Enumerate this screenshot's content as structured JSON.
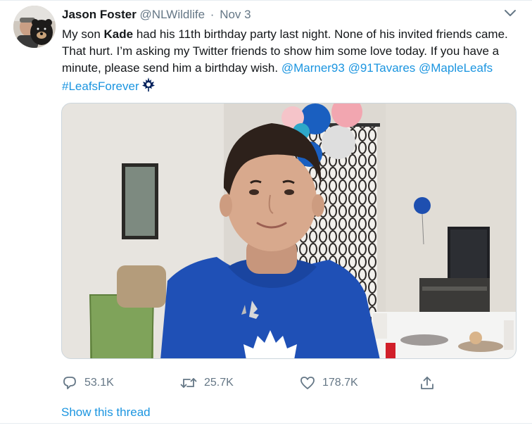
{
  "author": {
    "display_name": "Jason Foster",
    "handle": "@NLWildlife",
    "separator": "·",
    "timestamp": "Nov 3"
  },
  "tweet": {
    "text_1": "My son ",
    "text_bold": "Kade",
    "text_2": " had his 11th birthday party last night. None of his invited friends came. That hurt. I’m asking my Twitter friends to show him some love today. If you have a minute, please send him a birthday wish. ",
    "mention_1": "@Marner93",
    "mention_2": "@91Tavares",
    "mention_3": "@MapleLeafs",
    "hashtag": "#LeafsForever",
    "hashtag_emoji": "maple-leaf-icon"
  },
  "actions": {
    "reply_count": "53.1K",
    "retweet_count": "25.7K",
    "like_count": "178.7K"
  },
  "show_thread_label": "Show this thread",
  "colors": {
    "link": "#1b95e0",
    "secondary_text": "#657786",
    "leafs_blue": "#00205b",
    "shirt_blue": "#1d4fb3"
  },
  "icons": [
    "chevron-down-icon",
    "reply-icon",
    "retweet-icon",
    "heart-icon",
    "share-icon",
    "maple-leaf-icon"
  ]
}
